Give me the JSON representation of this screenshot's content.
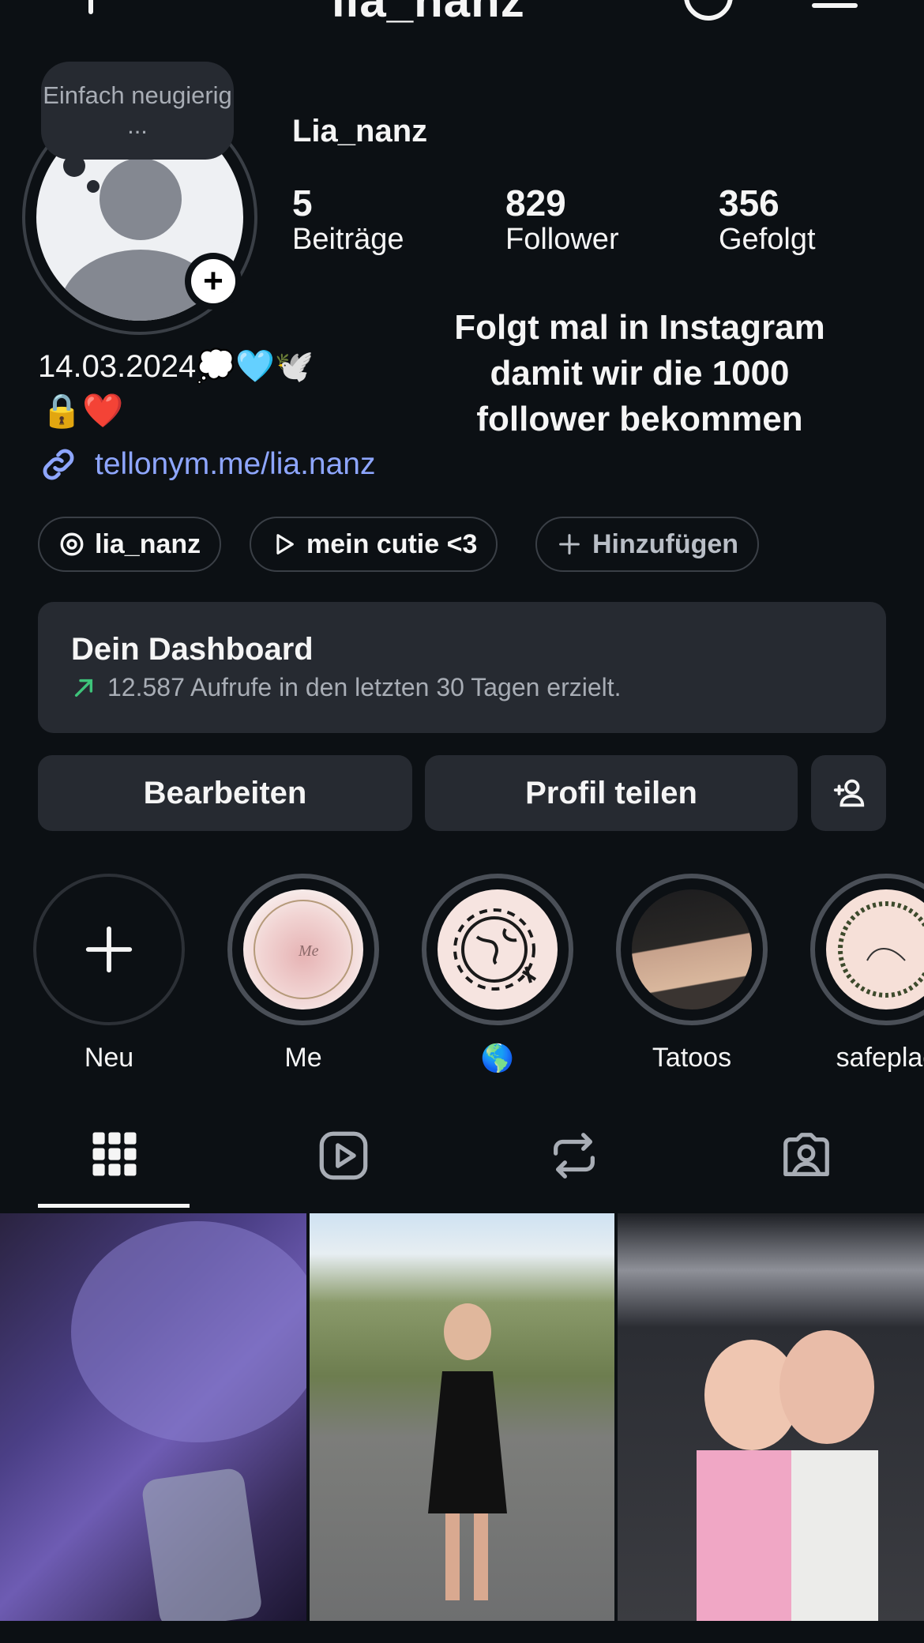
{
  "header": {
    "username": "lia_nanz"
  },
  "profile": {
    "note": "Einfach neugierig ...",
    "display_name": "Lia_nanz",
    "stats": [
      {
        "value": "5",
        "label": "Beiträge"
      },
      {
        "value": "829",
        "label": "Follower"
      },
      {
        "value": "356",
        "label": "Gefolgt"
      }
    ],
    "bio_line1": "14.03.2024💭🩵🕊️",
    "bio_line2": "🔒❤️",
    "bio_notice": "Folgt mal in Instagram damit wir die 1000 follower bekommen",
    "link": "tellonym.me/lia.nanz"
  },
  "pills": [
    {
      "label": "lia_nanz",
      "icon": "threads-icon"
    },
    {
      "label": "mein cutie <3",
      "icon": "play-icon"
    },
    {
      "label": "Hinzufügen",
      "icon": "plus-icon"
    }
  ],
  "dashboard": {
    "title": "Dein Dashboard",
    "subtitle": "12.587 Aufrufe in den letzten 30 Tagen erzielt."
  },
  "actions": {
    "edit": "Bearbeiten",
    "share": "Profil teilen"
  },
  "highlights": [
    {
      "label": "Neu"
    },
    {
      "label": "Me"
    },
    {
      "label": "🌎"
    },
    {
      "label": "Tatoos"
    },
    {
      "label": "safeplac"
    }
  ],
  "tabs": [
    "grid-icon",
    "reels-icon",
    "reposts-icon",
    "tagged-icon"
  ],
  "colors": {
    "background": "#0c1014",
    "surface": "#262a31",
    "link": "#8ea6ff",
    "trend": "#3ec47a"
  }
}
